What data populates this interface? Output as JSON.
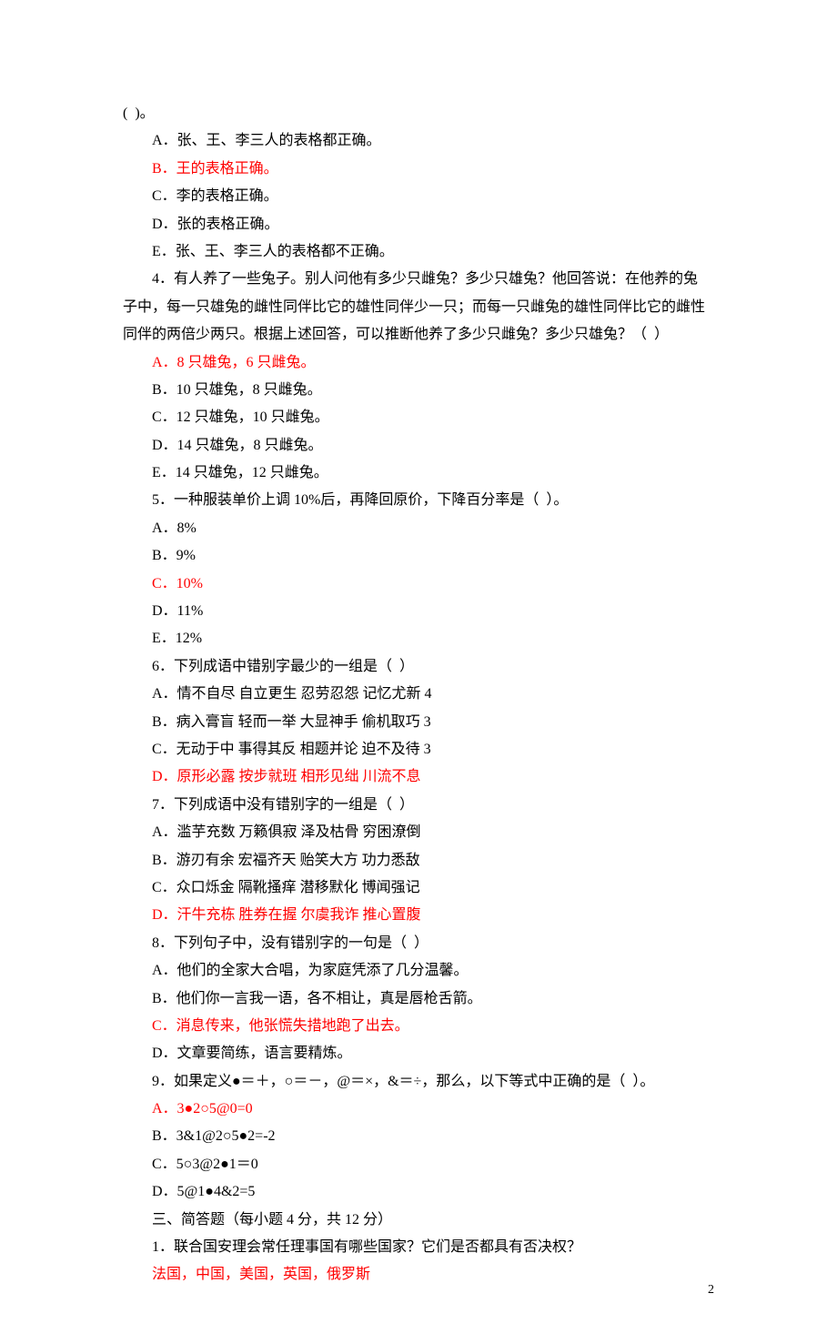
{
  "lines": [
    {
      "text": "(  )。",
      "indent": 0,
      "red": false
    },
    {
      "text": "A．张、王、李三人的表格都正确。",
      "indent": 1,
      "red": false
    },
    {
      "text": "B．王的表格正确。",
      "indent": 1,
      "red": true
    },
    {
      "text": "C．李的表格正确。",
      "indent": 1,
      "red": false
    },
    {
      "text": "D．张的表格正确。",
      "indent": 1,
      "red": false
    },
    {
      "text": "E．张、王、李三人的表格都不正确。",
      "indent": 1,
      "red": false
    },
    {
      "text": "4．有人养了一些兔子。别人问他有多少只雌兔？多少只雄兔？他回答说：在他养的兔",
      "indent": 1,
      "red": false
    },
    {
      "text": "子中，每一只雄兔的雌性同伴比它的雄性同伴少一只；而每一只雌兔的雄性同伴比它的雌性",
      "indent": 0,
      "red": false
    },
    {
      "text": "同伴的两倍少两只。根据上述回答，可以推断他养了多少只雌兔？多少只雄兔？（  ）",
      "indent": 0,
      "red": false
    },
    {
      "text": "A．8 只雄兔，6 只雌兔。",
      "indent": 1,
      "red": true
    },
    {
      "text": "B．10 只雄兔，8 只雌兔。",
      "indent": 1,
      "red": false
    },
    {
      "text": "C．12 只雄兔，10 只雌兔。",
      "indent": 1,
      "red": false
    },
    {
      "text": "D．14 只雄兔，8 只雌兔。",
      "indent": 1,
      "red": false
    },
    {
      "text": "E．14 只雄兔，12 只雌兔。",
      "indent": 1,
      "red": false
    },
    {
      "text": "5．一种服装单价上调 10%后，再降回原价，下降百分率是（  ）。",
      "indent": 1,
      "red": false
    },
    {
      "text": "A．8%",
      "indent": 1,
      "red": false
    },
    {
      "text": "B．9%",
      "indent": 1,
      "red": false
    },
    {
      "text": "C．10%",
      "indent": 1,
      "red": true
    },
    {
      "text": "D．11%",
      "indent": 1,
      "red": false
    },
    {
      "text": "E．12%",
      "indent": 1,
      "red": false
    },
    {
      "text": "6．下列成语中错别字最少的一组是（  ）",
      "indent": 1,
      "red": false
    },
    {
      "text": "A．情不自尽 自立更生 忍劳忍怨 记忆尤新 4",
      "indent": 1,
      "red": false
    },
    {
      "text": "B．病入膏盲 轻而一举 大显神手 偷机取巧 3",
      "indent": 1,
      "red": false
    },
    {
      "text": "C．无动于中 事得其反 相题并论 迫不及待 3",
      "indent": 1,
      "red": false
    },
    {
      "text": "D．原形必露 按步就班 相形见绌 川流不息",
      "indent": 1,
      "red": true
    },
    {
      "text": "7．下列成语中没有错别字的一组是（  ）",
      "indent": 1,
      "red": false
    },
    {
      "text": "A．滥芋充数 万籁俱寂 泽及枯骨 穷困潦倒",
      "indent": 1,
      "red": false
    },
    {
      "text": "B．游刃有余 宏福齐天 贻笑大方 功力悉敌",
      "indent": 1,
      "red": false
    },
    {
      "text": "C．众口烁金 隔靴搔痒 潜移默化 博闻强记",
      "indent": 1,
      "red": false
    },
    {
      "text": "D．汗牛充栋 胜券在握 尔虞我诈 推心置腹",
      "indent": 1,
      "red": true
    },
    {
      "text": "8．下列句子中，没有错别字的一句是（  ）",
      "indent": 1,
      "red": false
    },
    {
      "text": "A．他们的全家大合唱，为家庭凭添了几分温馨。",
      "indent": 1,
      "red": false
    },
    {
      "text": "B．他们你一言我一语，各不相让，真是唇枪舌箭。",
      "indent": 1,
      "red": false
    },
    {
      "text": "C．消息传来，他张慌失措地跑了出去。",
      "indent": 1,
      "red": true
    },
    {
      "text": "D．文章要简练，语言要精炼。",
      "indent": 1,
      "red": false
    },
    {
      "text": "9．如果定义●＝＋，○＝－，@＝×，&＝÷，那么，以下等式中正确的是（  ）。",
      "indent": 1,
      "red": false
    },
    {
      "text": "A．3●2○5@0=0",
      "indent": 1,
      "red": true
    },
    {
      "text": "B．3&1@2○5●2=-2",
      "indent": 1,
      "red": false
    },
    {
      "text": "C．5○3@2●1＝0",
      "indent": 1,
      "red": false
    },
    {
      "text": "D．5@1●4&2=5",
      "indent": 1,
      "red": false
    },
    {
      "text": "",
      "indent": 1,
      "red": false
    },
    {
      "text": "三、简答题（每小题 4 分，共 12 分）",
      "indent": 1,
      "red": false
    },
    {
      "text": "1．联合国安理会常任理事国有哪些国家？它们是否都具有否决权？",
      "indent": 1,
      "red": false
    },
    {
      "text": "法国，中国，美国，英国，俄罗斯",
      "indent": 1,
      "red": true
    }
  ],
  "pageNumber": "2"
}
